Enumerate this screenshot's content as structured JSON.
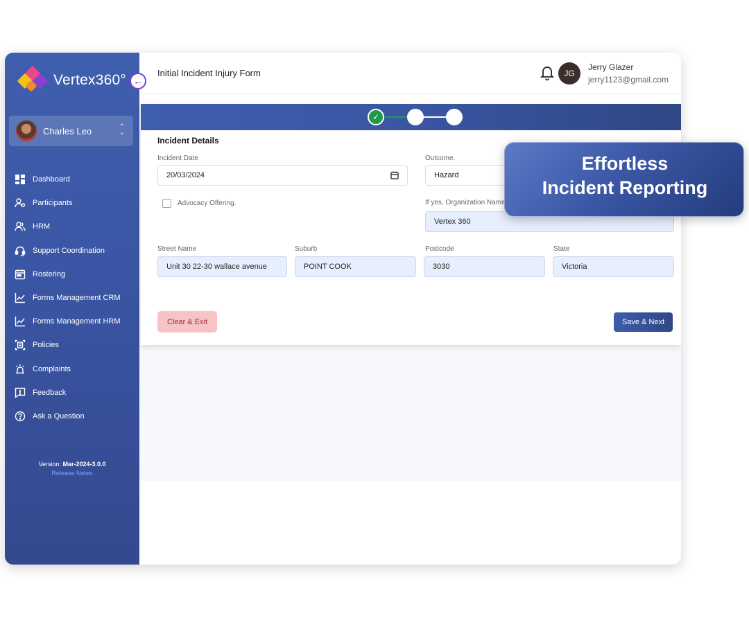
{
  "brand": {
    "name": "Vertex360°"
  },
  "sidebar": {
    "current_user": "Charles Leo",
    "items": [
      {
        "label": "Dashboard",
        "icon": "dashboard-icon"
      },
      {
        "label": "Participants",
        "icon": "participants-icon"
      },
      {
        "label": "HRM",
        "icon": "users-icon"
      },
      {
        "label": "Support Coordination",
        "icon": "headset-icon"
      },
      {
        "label": "Rostering",
        "icon": "calendar-icon"
      },
      {
        "label": "Forms Management CRM",
        "icon": "chart-line-icon"
      },
      {
        "label": "Forms Management HRM",
        "icon": "chart-line-icon"
      },
      {
        "label": "Policies",
        "icon": "document-icon"
      },
      {
        "label": "Complaints",
        "icon": "alarm-icon"
      },
      {
        "label": "Feedback",
        "icon": "feedback-icon"
      },
      {
        "label": "Ask a Question",
        "icon": "question-icon"
      }
    ],
    "version_prefix": "Version:",
    "version": "Mar-2024-3.0.0",
    "release_notes": "Release Notes"
  },
  "header": {
    "title": "Initial Incident Injury Form",
    "user_initials": "JG",
    "user_name": "Jerry Glazer",
    "user_email": "jerry1123@gmail.com"
  },
  "form": {
    "section_title": "Incident Details",
    "incident_date_label": "Incident Date",
    "incident_date_value": "20/03/2024",
    "outcome_label": "Outcome.",
    "outcome_value": "Hazard",
    "advocacy_label": "Advocacy Offering.",
    "advocacy_checked": false,
    "org_name_label": "If yes, Organization Name",
    "org_name_value": "Vertex 360",
    "street_label": "Street Name",
    "street_value": "Unit 30 22-30 wallace avenue",
    "suburb_label": "Suburb",
    "suburb_value": "POINT COOK",
    "postcode_label": "Postcode",
    "postcode_value": "3030",
    "state_label": "State",
    "state_value": "Victoria",
    "clear_label": "Clear & Exit",
    "save_label": "Save & Next",
    "steps_completed": 1,
    "steps_total": 3
  },
  "callout": {
    "line1": "Effortless",
    "line2": "Incident Reporting"
  },
  "colors": {
    "sidebar": "#3a55a3",
    "accent": "#7b3fd6",
    "step_done": "#1f9a4b",
    "clear_bg": "#f8c3c6",
    "save_bg": "#2f4786"
  }
}
